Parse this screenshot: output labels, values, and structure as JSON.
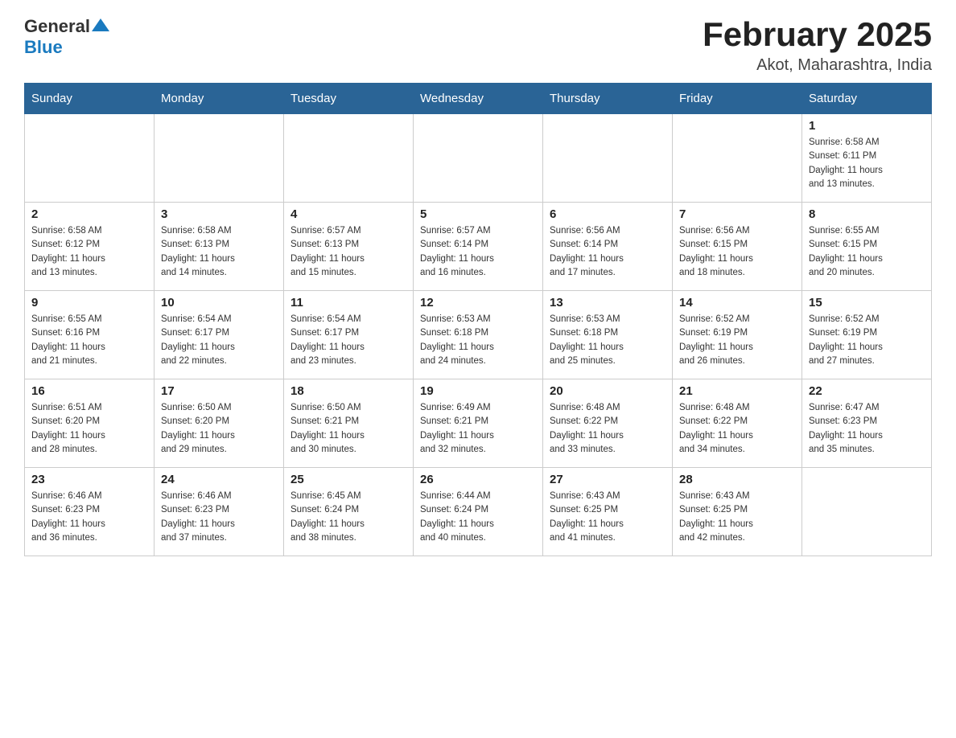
{
  "header": {
    "logo": {
      "general": "General",
      "blue": "Blue"
    },
    "title": "February 2025",
    "subtitle": "Akot, Maharashtra, India"
  },
  "days_of_week": [
    "Sunday",
    "Monday",
    "Tuesday",
    "Wednesday",
    "Thursday",
    "Friday",
    "Saturday"
  ],
  "weeks": [
    [
      {
        "day": "",
        "info": ""
      },
      {
        "day": "",
        "info": ""
      },
      {
        "day": "",
        "info": ""
      },
      {
        "day": "",
        "info": ""
      },
      {
        "day": "",
        "info": ""
      },
      {
        "day": "",
        "info": ""
      },
      {
        "day": "1",
        "info": "Sunrise: 6:58 AM\nSunset: 6:11 PM\nDaylight: 11 hours\nand 13 minutes."
      }
    ],
    [
      {
        "day": "2",
        "info": "Sunrise: 6:58 AM\nSunset: 6:12 PM\nDaylight: 11 hours\nand 13 minutes."
      },
      {
        "day": "3",
        "info": "Sunrise: 6:58 AM\nSunset: 6:13 PM\nDaylight: 11 hours\nand 14 minutes."
      },
      {
        "day": "4",
        "info": "Sunrise: 6:57 AM\nSunset: 6:13 PM\nDaylight: 11 hours\nand 15 minutes."
      },
      {
        "day": "5",
        "info": "Sunrise: 6:57 AM\nSunset: 6:14 PM\nDaylight: 11 hours\nand 16 minutes."
      },
      {
        "day": "6",
        "info": "Sunrise: 6:56 AM\nSunset: 6:14 PM\nDaylight: 11 hours\nand 17 minutes."
      },
      {
        "day": "7",
        "info": "Sunrise: 6:56 AM\nSunset: 6:15 PM\nDaylight: 11 hours\nand 18 minutes."
      },
      {
        "day": "8",
        "info": "Sunrise: 6:55 AM\nSunset: 6:15 PM\nDaylight: 11 hours\nand 20 minutes."
      }
    ],
    [
      {
        "day": "9",
        "info": "Sunrise: 6:55 AM\nSunset: 6:16 PM\nDaylight: 11 hours\nand 21 minutes."
      },
      {
        "day": "10",
        "info": "Sunrise: 6:54 AM\nSunset: 6:17 PM\nDaylight: 11 hours\nand 22 minutes."
      },
      {
        "day": "11",
        "info": "Sunrise: 6:54 AM\nSunset: 6:17 PM\nDaylight: 11 hours\nand 23 minutes."
      },
      {
        "day": "12",
        "info": "Sunrise: 6:53 AM\nSunset: 6:18 PM\nDaylight: 11 hours\nand 24 minutes."
      },
      {
        "day": "13",
        "info": "Sunrise: 6:53 AM\nSunset: 6:18 PM\nDaylight: 11 hours\nand 25 minutes."
      },
      {
        "day": "14",
        "info": "Sunrise: 6:52 AM\nSunset: 6:19 PM\nDaylight: 11 hours\nand 26 minutes."
      },
      {
        "day": "15",
        "info": "Sunrise: 6:52 AM\nSunset: 6:19 PM\nDaylight: 11 hours\nand 27 minutes."
      }
    ],
    [
      {
        "day": "16",
        "info": "Sunrise: 6:51 AM\nSunset: 6:20 PM\nDaylight: 11 hours\nand 28 minutes."
      },
      {
        "day": "17",
        "info": "Sunrise: 6:50 AM\nSunset: 6:20 PM\nDaylight: 11 hours\nand 29 minutes."
      },
      {
        "day": "18",
        "info": "Sunrise: 6:50 AM\nSunset: 6:21 PM\nDaylight: 11 hours\nand 30 minutes."
      },
      {
        "day": "19",
        "info": "Sunrise: 6:49 AM\nSunset: 6:21 PM\nDaylight: 11 hours\nand 32 minutes."
      },
      {
        "day": "20",
        "info": "Sunrise: 6:48 AM\nSunset: 6:22 PM\nDaylight: 11 hours\nand 33 minutes."
      },
      {
        "day": "21",
        "info": "Sunrise: 6:48 AM\nSunset: 6:22 PM\nDaylight: 11 hours\nand 34 minutes."
      },
      {
        "day": "22",
        "info": "Sunrise: 6:47 AM\nSunset: 6:23 PM\nDaylight: 11 hours\nand 35 minutes."
      }
    ],
    [
      {
        "day": "23",
        "info": "Sunrise: 6:46 AM\nSunset: 6:23 PM\nDaylight: 11 hours\nand 36 minutes."
      },
      {
        "day": "24",
        "info": "Sunrise: 6:46 AM\nSunset: 6:23 PM\nDaylight: 11 hours\nand 37 minutes."
      },
      {
        "day": "25",
        "info": "Sunrise: 6:45 AM\nSunset: 6:24 PM\nDaylight: 11 hours\nand 38 minutes."
      },
      {
        "day": "26",
        "info": "Sunrise: 6:44 AM\nSunset: 6:24 PM\nDaylight: 11 hours\nand 40 minutes."
      },
      {
        "day": "27",
        "info": "Sunrise: 6:43 AM\nSunset: 6:25 PM\nDaylight: 11 hours\nand 41 minutes."
      },
      {
        "day": "28",
        "info": "Sunrise: 6:43 AM\nSunset: 6:25 PM\nDaylight: 11 hours\nand 42 minutes."
      },
      {
        "day": "",
        "info": ""
      }
    ]
  ]
}
